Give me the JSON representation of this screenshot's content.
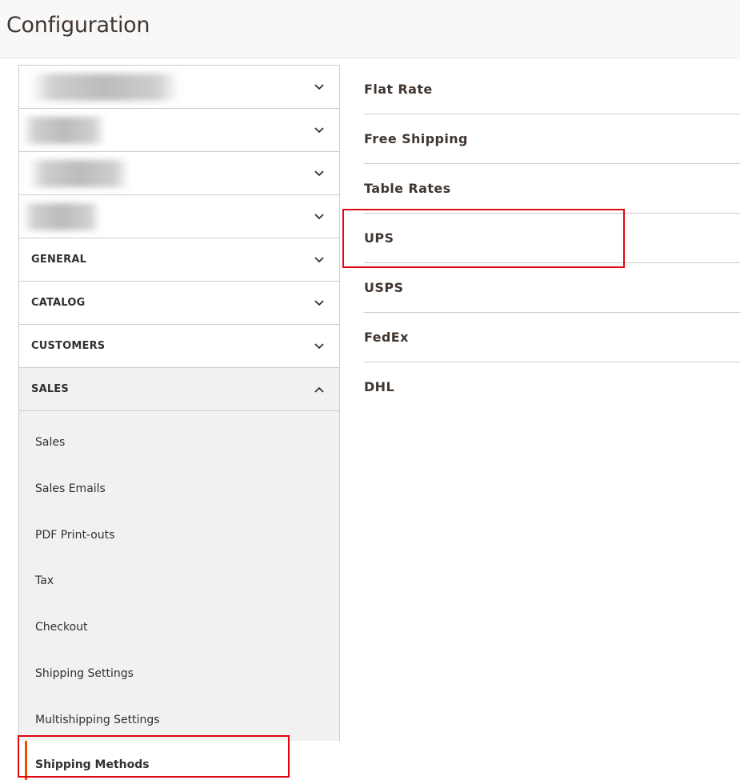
{
  "page": {
    "title": "Configuration"
  },
  "sidebar": {
    "obscured_sections": 4,
    "sections": [
      {
        "label": "GENERAL",
        "expanded": false
      },
      {
        "label": "CATALOG",
        "expanded": false
      },
      {
        "label": "CUSTOMERS",
        "expanded": false
      },
      {
        "label": "SALES",
        "expanded": true
      }
    ],
    "sales_items": [
      "Sales",
      "Sales Emails",
      "PDF Print-outs",
      "Tax",
      "Checkout",
      "Shipping Settings",
      "Multishipping Settings"
    ],
    "active_item": "Shipping Methods"
  },
  "methods": [
    "Flat Rate",
    "Free Shipping",
    "Table Rates",
    "UPS",
    "USPS",
    "FedEx",
    "DHL"
  ],
  "colors": {
    "accent": "#eb5202",
    "highlight": "#e30613",
    "section_open_bg": "#f1f1f1"
  },
  "icons": {
    "collapsed": "chevron-down-icon",
    "expanded": "chevron-up-icon"
  }
}
